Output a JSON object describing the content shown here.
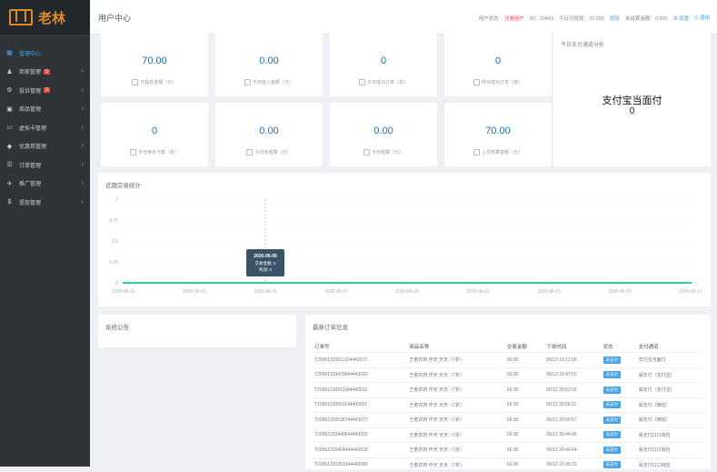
{
  "sidebar": {
    "logo_text": "老林",
    "items": [
      {
        "label": "管理中心",
        "icon": "dashboard-icon",
        "glyph": "▦",
        "badge": null,
        "active": true
      },
      {
        "label": "商家管理",
        "icon": "user-icon",
        "glyph": "♟",
        "badge": "0",
        "active": false
      },
      {
        "label": "投诉管理",
        "icon": "gear-icon",
        "glyph": "⚙",
        "badge": "0",
        "active": false
      },
      {
        "label": "商品管理",
        "icon": "shopping-bag-icon",
        "glyph": "▣",
        "badge": null,
        "active": false
      },
      {
        "label": "虚拟卡管理",
        "icon": "card-icon",
        "glyph": "▭",
        "badge": null,
        "active": false
      },
      {
        "label": "优惠券管理",
        "icon": "tag-icon",
        "glyph": "◆",
        "badge": null,
        "active": false
      },
      {
        "label": "订单管理",
        "icon": "list-icon",
        "glyph": "☰",
        "badge": null,
        "active": false
      },
      {
        "label": "推广管理",
        "icon": "send-icon",
        "glyph": "✈",
        "badge": null,
        "active": false
      },
      {
        "label": "提现管理",
        "icon": "dollar-icon",
        "glyph": "$",
        "badge": null,
        "active": false
      }
    ]
  },
  "header": {
    "title": "用户中心",
    "user_status_label": "用户状态",
    "user_status_value": "注册用户",
    "id_text": "ID：10443",
    "today_income": "今日可提现：70.000",
    "today_chip": "提现",
    "settle_text": "未结算金额：0.000",
    "settings": "设置",
    "logout": "退出"
  },
  "stats": [
    {
      "value": "70.00",
      "label": "可提现金额（元）"
    },
    {
      "value": "0.00",
      "label": "今日收入金额（元）"
    },
    {
      "value": "0",
      "label": "今日成功订单（单）"
    },
    {
      "value": "0",
      "label": "昨日成功订单（单）"
    },
    {
      "value": "0",
      "label": "今日卖出卡数（张）"
    },
    {
      "value": "0.00",
      "label": "今日未结算（元）"
    },
    {
      "value": "0.00",
      "label": "今日结算（元）"
    },
    {
      "value": "70.00",
      "label": "上月结算金额（元）"
    }
  ],
  "alipay": {
    "title": "今日支付通道分析",
    "main": "支付宝当面付",
    "value": "0"
  },
  "chart_data": {
    "type": "line",
    "title": "近期交易统计",
    "x": [
      "2020-06-01",
      "2020-06-03",
      "2020-06-05",
      "2020-06-07",
      "2020-06-09",
      "2020-06-11",
      "2020-06-13",
      "2020-06-15",
      "2020-06-17"
    ],
    "ylim": [
      0,
      1
    ],
    "yticks": [
      "1",
      "0.75",
      "0.5",
      "0.25",
      "0"
    ],
    "series": [
      {
        "values": [
          0,
          0,
          0,
          0,
          0,
          0,
          0,
          0,
          0
        ],
        "color": "#2ecc9a"
      }
    ],
    "tooltip": {
      "date": "2020-06-05",
      "line1": "交易金额: 0",
      "line2": "利润: 0"
    }
  },
  "notice": {
    "title": "系统公告"
  },
  "orders": {
    "title": "最新订单信息",
    "columns": [
      "订单号",
      "商品名称",
      "交易金额",
      "下单时间",
      "状态",
      "支付通道"
    ],
    "rows": [
      [
        "T20061315911104443072",
        "王者农药 作天 天天（7折）",
        "66.00",
        "06/13 19:12:09",
        "未支付",
        "支付宝当面付"
      ],
      [
        "T20061319479044443020",
        "王者农药 作天 天天（7折）",
        "66.00",
        "06/13 19:47:53",
        "未支付",
        "易支付（支付宝）"
      ],
      [
        "T20061220911944443012",
        "王者农药 作天 天天（7折）",
        "66.00",
        "06/12 20:53:16",
        "未支付",
        "易支付（支付宝）"
      ],
      [
        "T20061220551144443031",
        "王者农药 作天 天天（7折）",
        "66.00",
        "06/12 20:55:11",
        "未支付",
        "易支付（微信）"
      ],
      [
        "T20061220505744443077",
        "王者农药 作天 天天（7折）",
        "66.00",
        "06/12 20:50:57",
        "未支付",
        "易支付（微信）"
      ],
      [
        "T20061220440644443032",
        "王者农药 作天 天天（7折）",
        "66.00",
        "06/12 20:44:06",
        "未支付",
        "易支付口口钱包"
      ],
      [
        "T20061220424444443020",
        "王者农药 作天 天天（7折）",
        "66.00",
        "06/12 20:42:44",
        "未支付",
        "易支付口口钱包"
      ],
      [
        "T20061220353344443080",
        "王者农药 作天 天天（7折）",
        "66.00",
        "06/12 20:35:33",
        "未支付",
        "易支付口口钱包"
      ]
    ]
  }
}
